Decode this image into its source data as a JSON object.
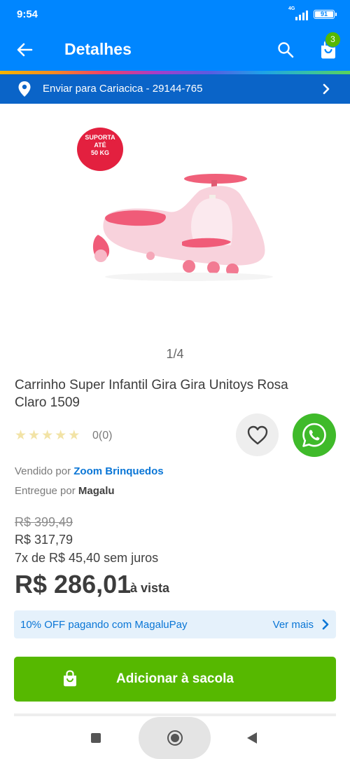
{
  "status_bar": {
    "time": "9:54",
    "network": "4G",
    "battery": "91"
  },
  "header": {
    "title": "Detalhes",
    "cart_count": "3"
  },
  "shipping": {
    "text": "Enviar para Cariacica - 29144-765"
  },
  "gallery": {
    "badge_lines": [
      "SUPORTA",
      "ATÉ",
      "50 KG"
    ],
    "counter": "1/4"
  },
  "product": {
    "title": "Carrinho Super Infantil Gira Gira Unitoys Rosa Claro 1509",
    "rating_count": "0(0)",
    "stars": 5,
    "seller_prefix": "Vendido por",
    "seller_name": "Zoom Brinquedos",
    "delivery_prefix": "Entregue por",
    "delivery_name": "Magalu"
  },
  "pricing": {
    "old_price": "R$ 399,49",
    "price": "R$ 317,79",
    "installments": "7x de R$ 45,40 sem juros",
    "cash_price": "R$ 286,01",
    "cash_suffix": "à vista"
  },
  "promo": {
    "text": "10% OFF pagando com MagaluPay",
    "more": "Ver mais"
  },
  "actions": {
    "add_to_bag": "Adicionar à sacola"
  },
  "colors": {
    "primary_blue": "#0086ff",
    "ship_blue": "#0a64c8",
    "buy_green": "#56b800",
    "whatsapp_green": "#3fba2a",
    "link_blue": "#0a76d6"
  }
}
